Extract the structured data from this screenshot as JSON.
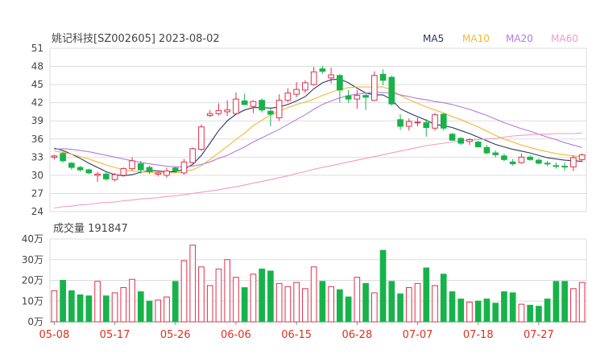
{
  "title": "姚记科技[SZ002605] 2023-08-02",
  "volume_title": "成交量 191847",
  "legend": [
    {
      "name": "MA5",
      "color": "#2d3561"
    },
    {
      "name": "MA10",
      "color": "#f5b731"
    },
    {
      "name": "MA20",
      "color": "#b57bdb"
    },
    {
      "name": "MA60",
      "color": "#f59ac4"
    }
  ],
  "colors": {
    "up": "#e0304a",
    "down": "#17b34a",
    "grid": "#dddddd",
    "axis": "#444444"
  },
  "chart_data": [
    {
      "type": "candlestick",
      "title": "姚记科技[SZ002605] 2023-08-02",
      "ylim": [
        24,
        51
      ],
      "y_ticks": [
        24,
        27,
        30,
        33,
        36,
        39,
        42,
        45,
        48,
        51
      ],
      "x_ticks": [
        {
          "label": "05-08",
          "index": 0
        },
        {
          "label": "05-17",
          "index": 7
        },
        {
          "label": "05-26",
          "index": 14
        },
        {
          "label": "06-06",
          "index": 21
        },
        {
          "label": "06-15",
          "index": 28
        },
        {
          "label": "06-28",
          "index": 35
        },
        {
          "label": "07-07",
          "index": 42
        },
        {
          "label": "07-18",
          "index": 49
        },
        {
          "label": "07-27",
          "index": 56
        }
      ],
      "ohlc": [
        [
          33.0,
          33.4,
          32.6,
          33.2
        ],
        [
          33.6,
          33.9,
          32.1,
          32.4
        ],
        [
          32.0,
          32.2,
          30.9,
          31.3
        ],
        [
          31.3,
          31.6,
          30.6,
          30.9
        ],
        [
          30.9,
          31.1,
          30.2,
          30.4
        ],
        [
          30.0,
          30.6,
          28.9,
          30.2
        ],
        [
          30.2,
          30.5,
          29.1,
          29.4
        ],
        [
          29.3,
          30.4,
          29.0,
          30.1
        ],
        [
          30.0,
          31.3,
          29.8,
          31.1
        ],
        [
          31.1,
          33.0,
          30.8,
          32.4
        ],
        [
          31.9,
          32.4,
          30.3,
          30.9
        ],
        [
          31.3,
          31.6,
          30.2,
          30.6
        ],
        [
          30.2,
          30.6,
          29.8,
          30.4
        ],
        [
          30.0,
          31.2,
          29.6,
          30.7
        ],
        [
          31.2,
          31.4,
          30.4,
          30.7
        ],
        [
          30.4,
          32.7,
          30.1,
          32.2
        ],
        [
          32.1,
          34.6,
          32.0,
          34.4
        ],
        [
          34.3,
          38.4,
          34.0,
          38.0
        ],
        [
          39.9,
          40.8,
          39.6,
          40.2
        ],
        [
          40.2,
          41.9,
          39.9,
          40.7
        ],
        [
          40.5,
          42.4,
          39.8,
          40.8
        ],
        [
          40.2,
          43.7,
          40.0,
          42.6
        ],
        [
          42.3,
          43.5,
          41.6,
          41.7
        ],
        [
          41.4,
          42.4,
          40.3,
          42.2
        ],
        [
          42.4,
          42.7,
          40.4,
          40.8
        ],
        [
          40.6,
          41.0,
          38.1,
          40.1
        ],
        [
          39.5,
          43.4,
          39.0,
          42.4
        ],
        [
          42.4,
          44.4,
          42.1,
          43.6
        ],
        [
          43.4,
          45.4,
          42.9,
          44.2
        ],
        [
          44.1,
          45.7,
          43.6,
          45.3
        ],
        [
          45.0,
          47.9,
          44.8,
          47.1
        ],
        [
          47.6,
          48.1,
          46.8,
          47.2
        ],
        [
          46.1,
          47.8,
          45.2,
          46.6
        ],
        [
          46.5,
          46.7,
          42.0,
          44.1
        ],
        [
          43.1,
          44.1,
          42.0,
          42.6
        ],
        [
          42.6,
          44.1,
          41.0,
          43.2
        ],
        [
          43.2,
          43.6,
          40.8,
          42.9
        ],
        [
          42.4,
          47.2,
          42.3,
          46.5
        ],
        [
          46.7,
          47.5,
          44.9,
          45.7
        ],
        [
          46.2,
          46.5,
          41.5,
          41.8
        ],
        [
          39.2,
          40.1,
          37.5,
          38.1
        ],
        [
          38.1,
          39.4,
          37.4,
          38.9
        ],
        [
          38.7,
          39.5,
          38.1,
          38.8
        ],
        [
          38.7,
          39.3,
          36.4,
          37.9
        ],
        [
          37.8,
          40.3,
          37.4,
          40.0
        ],
        [
          40.1,
          40.3,
          37.4,
          37.8
        ],
        [
          36.8,
          37.0,
          35.7,
          35.8
        ],
        [
          36.1,
          36.3,
          35.0,
          35.3
        ],
        [
          35.6,
          36.1,
          35.0,
          35.9
        ],
        [
          35.5,
          35.7,
          34.6,
          34.7
        ],
        [
          34.6,
          35.0,
          33.5,
          33.7
        ],
        [
          33.7,
          34.1,
          33.0,
          33.4
        ],
        [
          33.2,
          33.6,
          32.3,
          32.6
        ],
        [
          32.2,
          32.7,
          31.6,
          31.9
        ],
        [
          32.1,
          33.6,
          31.9,
          33.0
        ],
        [
          33.0,
          33.3,
          32.4,
          32.6
        ],
        [
          32.5,
          32.8,
          31.8,
          32.0
        ],
        [
          32.0,
          32.4,
          31.5,
          31.9
        ],
        [
          31.6,
          32.1,
          31.1,
          31.5
        ],
        [
          31.5,
          32.1,
          30.8,
          31.4
        ],
        [
          31.4,
          33.3,
          30.7,
          32.9
        ],
        [
          32.6,
          33.6,
          32.2,
          33.4
        ]
      ],
      "ma_series": [
        {
          "name": "MA5",
          "values": [
            34.5,
            34.1,
            33.5,
            32.8,
            32.0,
            31.3,
            30.6,
            30.1,
            29.9,
            30.1,
            30.5,
            30.8,
            30.7,
            30.6,
            30.6,
            31.0,
            31.8,
            33.3,
            35.3,
            37.4,
            39.0,
            40.1,
            40.8,
            41.2,
            41.2,
            41.1,
            41.3,
            41.7,
            42.3,
            43.0,
            44.3,
            45.3,
            45.8,
            45.9,
            45.3,
            44.4,
            43.6,
            43.3,
            43.3,
            42.5,
            41.0,
            40.3,
            39.7,
            39.1,
            38.4,
            38.2,
            37.9,
            37.4,
            36.9,
            36.3,
            35.7,
            35.1,
            34.7,
            34.3,
            34.0,
            33.7,
            33.3,
            32.9,
            32.7,
            32.5,
            32.4,
            32.3
          ]
        },
        {
          "name": "MA10",
          "values": [
            34.0,
            33.8,
            33.5,
            33.1,
            32.7,
            32.2,
            31.7,
            31.3,
            30.9,
            30.7,
            30.6,
            30.5,
            30.4,
            30.4,
            30.4,
            30.6,
            30.9,
            31.6,
            32.6,
            33.7,
            34.8,
            35.9,
            37.0,
            38.2,
            39.1,
            40.0,
            40.6,
            41.2,
            41.7,
            42.1,
            42.6,
            43.2,
            43.7,
            44.2,
            44.5,
            44.6,
            44.6,
            44.6,
            44.6,
            44.1,
            43.2,
            42.5,
            41.9,
            41.3,
            40.8,
            40.3,
            39.7,
            39.2,
            38.6,
            38.0,
            37.3,
            36.6,
            36.0,
            35.5,
            35.0,
            34.6,
            34.2,
            33.9,
            33.6,
            33.4,
            33.2,
            33.1
          ]
        },
        {
          "name": "MA20",
          "values": [
            34.3,
            34.4,
            34.3,
            34.1,
            33.9,
            33.6,
            33.3,
            33.0,
            32.7,
            32.4,
            32.1,
            31.9,
            31.7,
            31.5,
            31.4,
            31.4,
            31.5,
            31.8,
            32.2,
            32.8,
            33.3,
            34.0,
            34.7,
            35.5,
            36.2,
            36.9,
            37.6,
            38.4,
            39.2,
            40.0,
            40.9,
            41.7,
            42.3,
            42.8,
            43.2,
            43.4,
            43.6,
            43.7,
            43.7,
            43.6,
            43.3,
            43.0,
            42.7,
            42.5,
            42.2,
            42.0,
            41.7,
            41.3,
            40.9,
            40.4,
            39.9,
            39.3,
            38.7,
            38.2,
            37.7,
            37.3,
            36.8,
            36.3,
            35.9,
            35.4,
            35.0,
            34.6
          ]
        },
        {
          "name": "MA60",
          "values": [
            24.6,
            24.8,
            24.9,
            25.1,
            25.2,
            25.4,
            25.5,
            25.6,
            25.8,
            25.9,
            26.1,
            26.2,
            26.3,
            26.5,
            26.6,
            26.8,
            27.0,
            27.2,
            27.4,
            27.6,
            27.9,
            28.1,
            28.4,
            28.7,
            29.0,
            29.3,
            29.6,
            29.9,
            30.3,
            30.6,
            31.0,
            31.3,
            31.6,
            31.9,
            32.2,
            32.5,
            32.8,
            33.1,
            33.4,
            33.7,
            34.0,
            34.3,
            34.6,
            34.9,
            35.1,
            35.3,
            35.5,
            35.7,
            35.8,
            35.9,
            36.0,
            36.1,
            36.3,
            36.5,
            36.6,
            36.7,
            36.8,
            36.8,
            36.9,
            36.9,
            36.9,
            37.0
          ]
        }
      ]
    },
    {
      "type": "bar",
      "title": "成交量 191847",
      "ylim": [
        0,
        400000
      ],
      "y_ticks": [
        "0万",
        "10万",
        "20万",
        "30万",
        "40万"
      ],
      "y_tick_values": [
        0,
        100000,
        200000,
        300000,
        400000
      ],
      "volume": [
        150000,
        200000,
        150000,
        130000,
        125000,
        195000,
        125000,
        140000,
        165000,
        205000,
        145000,
        100000,
        105000,
        120000,
        195000,
        295000,
        370000,
        265000,
        175000,
        255000,
        300000,
        215000,
        165000,
        230000,
        255000,
        245000,
        185000,
        170000,
        190000,
        160000,
        265000,
        195000,
        170000,
        155000,
        120000,
        215000,
        185000,
        140000,
        345000,
        195000,
        135000,
        165000,
        185000,
        260000,
        175000,
        230000,
        145000,
        110000,
        95000,
        100000,
        110000,
        90000,
        145000,
        140000,
        85000,
        80000,
        75000,
        110000,
        195000,
        195000,
        160000,
        190000
      ]
    }
  ]
}
